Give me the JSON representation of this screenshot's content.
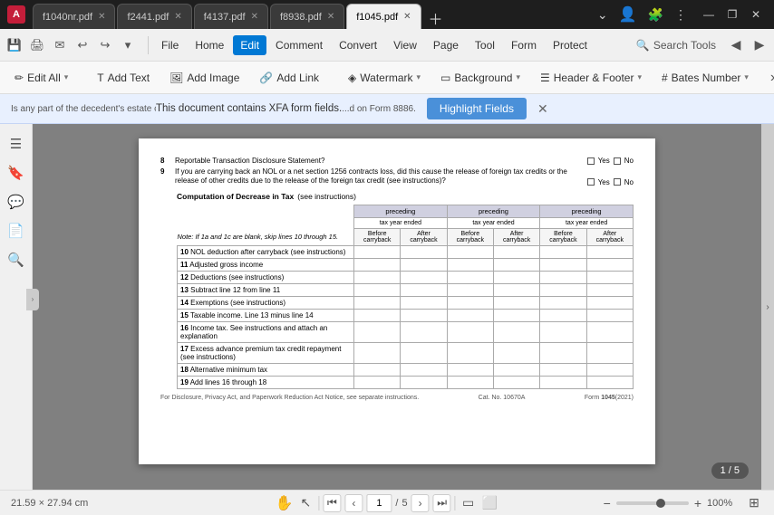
{
  "app": {
    "icon": "A",
    "icon_label": "Adobe Acrobat"
  },
  "tabs": [
    {
      "id": "tab1",
      "label": "f1040nr.pdf",
      "active": false
    },
    {
      "id": "tab2",
      "label": "f2441.pdf",
      "active": false
    },
    {
      "id": "tab3",
      "label": "f4137.pdf",
      "active": false
    },
    {
      "id": "tab4",
      "label": "f8938.pdf",
      "active": false
    },
    {
      "id": "tab5",
      "label": "f1045.pdf",
      "active": true
    }
  ],
  "window_controls": {
    "minimize": "—",
    "restore": "❐",
    "close": "✕"
  },
  "menu": {
    "file": "File",
    "home": "Home",
    "edit": "Edit",
    "comment": "Comment",
    "convert": "Convert",
    "view": "View",
    "page": "Page",
    "tool": "Tool",
    "form": "Form",
    "protect": "Protect",
    "search_tools": "Search Tools"
  },
  "quick_tools": {
    "save": "💾",
    "print": "🖨",
    "email": "✉",
    "undo": "↩",
    "redo": "↪",
    "more": "▾"
  },
  "toolbar": {
    "edit_all": "Edit All",
    "add_text": "Add Text",
    "add_image": "Add Image",
    "add_link": "Add Link",
    "watermark": "Watermark",
    "background": "Background",
    "header_footer": "Header & Footer",
    "bates_number": "Bates Number"
  },
  "xfa_banner": {
    "text": "This document contains XFA form fields.",
    "left_text": "Is any part of the decedent's estate currently under examination by the IRS? If...",
    "right_text": "...d on Form 8886.",
    "button_label": "Highlight Fields",
    "close": "✕"
  },
  "sidebar": {
    "icons": [
      "☰",
      "🔖",
      "💬",
      "📋",
      "🔍"
    ]
  },
  "pdf": {
    "row8": {
      "num": "8",
      "desc": "Reportable Transaction Disclosure Statement?",
      "yes": "Yes",
      "no": "No"
    },
    "question9": "If you are carrying back an NOL or a net section 1256 contracts loss, did this cause the release of foreign tax credits or the release of other credits due to the release of the foreign tax credit (see instructions)?",
    "row9": {
      "yes": "Yes",
      "no": "No"
    },
    "computation_title": "Computation of Decrease in Tax",
    "computation_see": "(see instructions)",
    "preceding_label": "preceding",
    "tax_year_ended": "tax year ended",
    "before_carryback": "Before carryback",
    "after_carryback": "After carryback",
    "note": "Note: If 1a and 1c are blank, skip lines 10 through 15.",
    "rows": [
      {
        "num": "10",
        "desc": "NOL deduction after carryback (see instructions)"
      },
      {
        "num": "11",
        "desc": "Adjusted gross income"
      },
      {
        "num": "12",
        "desc": "Deductions (see instructions)"
      },
      {
        "num": "13",
        "desc": "Subtract line 12 from line 11"
      },
      {
        "num": "14",
        "desc": "Exemptions (see instructions)"
      },
      {
        "num": "15",
        "desc": "Taxable income. Line 13 minus line 14"
      },
      {
        "num": "16",
        "desc": "Income tax. See instructions and attach an explanation"
      },
      {
        "num": "17",
        "desc": "Excess advance premium tax credit repayment (see instructions)"
      },
      {
        "num": "18",
        "desc": "Alternative minimum tax"
      },
      {
        "num": "19",
        "desc": "Add lines 16 through 18"
      }
    ],
    "footer_left": "For Disclosure, Privacy Act, and Paperwork Reduction Act Notice, see separate instructions.",
    "footer_cat": "Cat. No. 10670A",
    "footer_form": "Form",
    "footer_num": "1045",
    "footer_year": "(2021)",
    "page_info": "1 / 5"
  },
  "status_bar": {
    "dimensions": "21.59 × 27.94 cm",
    "page_current": "1",
    "page_total": "5",
    "zoom_percent": "100%",
    "page_indicator": "1 / 5"
  }
}
